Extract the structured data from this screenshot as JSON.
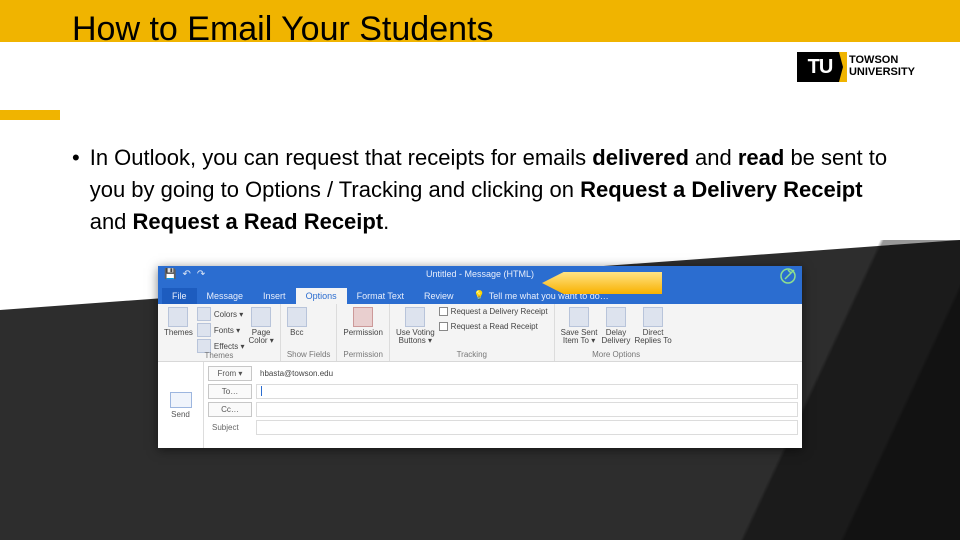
{
  "slide": {
    "title": "How to Email Your Students",
    "logo_mark": "TU",
    "logo_line1": "TOWSON",
    "logo_line2": "UNIVERSITY",
    "bullet_prefix": "•",
    "bullet_seg1": "In Outlook, you can request that receipts for emails ",
    "bullet_b1": "delivered",
    "bullet_seg2": " and ",
    "bullet_b2": "read",
    "bullet_seg3": " be sent to you by going to Options / Tracking and clicking on ",
    "bullet_b3": "Request a Delivery Receipt",
    "bullet_seg4": " and ",
    "bullet_b4": "Request a Read Receipt",
    "bullet_seg5": "."
  },
  "outlook": {
    "window_title": "Untitled - Message (HTML)",
    "qat_save_icon": "💾",
    "qat_undo_icon": "↶",
    "qat_redo_icon": "↷",
    "tabs": {
      "file": "File",
      "message": "Message",
      "insert": "Insert",
      "options": "Options",
      "format_text": "Format Text",
      "review": "Review",
      "tell_me": "Tell me what you want to do…",
      "tell_me_icon": "💡"
    },
    "ribbon": {
      "themes_item": "Themes",
      "colors": "Colors ▾",
      "fonts": "Fonts ▾",
      "effects": "Effects ▾",
      "page_color": "Page\nColor ▾",
      "themes_group": "Themes",
      "bcc": "Bcc",
      "show_fields_group": "Show Fields",
      "permission": "Permission",
      "permission_group": "Permission",
      "voting": "Use Voting\nButtons ▾",
      "req_delivery": "Request a Delivery Receipt",
      "req_read": "Request a Read Receipt",
      "tracking_group": "Tracking",
      "save_sent": "Save Sent\nItem To ▾",
      "delay": "Delay\nDelivery",
      "direct": "Direct\nReplies To",
      "more_options_group": "More Options"
    },
    "compose": {
      "send": "Send",
      "from_btn": "From ▾",
      "from_value": "hbasta@towson.edu",
      "to_btn": "To…",
      "cc_btn": "Cc…",
      "subject_label": "Subject"
    }
  }
}
